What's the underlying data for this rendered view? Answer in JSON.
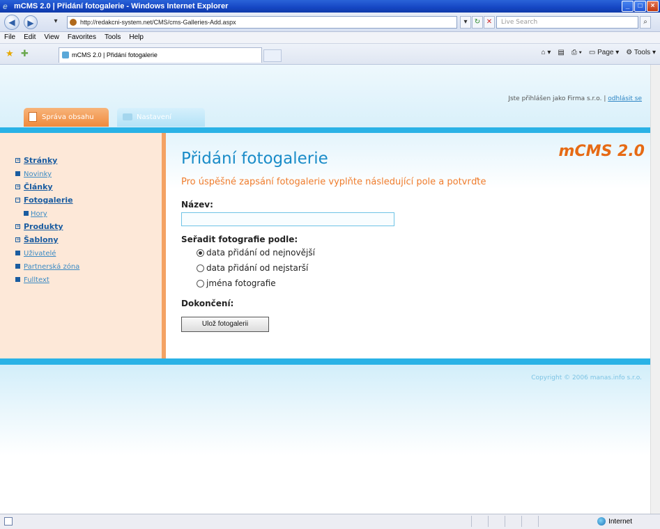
{
  "window": {
    "title": "mCMS 2.0 | Přidání fotogalerie - Windows Internet Explorer"
  },
  "address": {
    "url": "http://redakcni-system.net/CMS/cms-Galleries-Add.aspx",
    "search_placeholder": "Live Search"
  },
  "menu": [
    "File",
    "Edit",
    "View",
    "Favorites",
    "Tools",
    "Help"
  ],
  "browser_tab": {
    "label": "mCMS 2.0 | Přidání fotogalerie"
  },
  "toolbar": {
    "page": "Page",
    "tools": "Tools"
  },
  "header": {
    "logged_in_text": "Jste přihlášen jako Firma s.r.o. |",
    "logout": "odhlásit se",
    "tab_active": "Správa obsahu",
    "tab_inactive": "Nastavení"
  },
  "sidebar": {
    "items": [
      {
        "label": "Stránky",
        "type": "plus",
        "style": "strong"
      },
      {
        "label": "Novinky",
        "type": "bullet",
        "style": "light"
      },
      {
        "label": "Články",
        "type": "plus",
        "style": "strong"
      },
      {
        "label": "Fotogalerie",
        "type": "minus",
        "style": "strong"
      },
      {
        "label": "Hory",
        "type": "bullet",
        "style": "light",
        "sub": true
      },
      {
        "label": "Produkty",
        "type": "plus",
        "style": "strong"
      },
      {
        "label": "Šablony",
        "type": "plus",
        "style": "strong"
      },
      {
        "label": "Uživatelé",
        "type": "bullet",
        "style": "light"
      },
      {
        "label": "Partnerská zóna",
        "type": "bullet",
        "style": "light"
      },
      {
        "label": "Fulltext",
        "type": "bullet",
        "style": "light"
      }
    ]
  },
  "main": {
    "brand": "mCMS 2.0",
    "title": "Přidání fotogalerie",
    "subtitle": "Pro úspěšné zapsání fotogalerie vyplňte následující pole a potvrďte",
    "name_label": "Název:",
    "name_value": "",
    "sort_label": "Seřadit fotografie podle:",
    "sort_options": [
      {
        "label": "data přidání od nejnovější",
        "selected": true
      },
      {
        "label": "data přidání od nejstarší",
        "selected": false
      },
      {
        "label": "jména fotografie",
        "selected": false
      }
    ],
    "finish_label": "Dokončení:",
    "save_button": "Ulož fotogalerii"
  },
  "footer": {
    "copyright": "Copyright © 2006 manas.info s.r.o."
  },
  "status": {
    "zone": "Internet"
  },
  "colors": {
    "accent_blue": "#2ab2e6",
    "accent_orange": "#f08a3c",
    "title_blue": "#1a8cc8",
    "brand_orange": "#e66a14"
  }
}
